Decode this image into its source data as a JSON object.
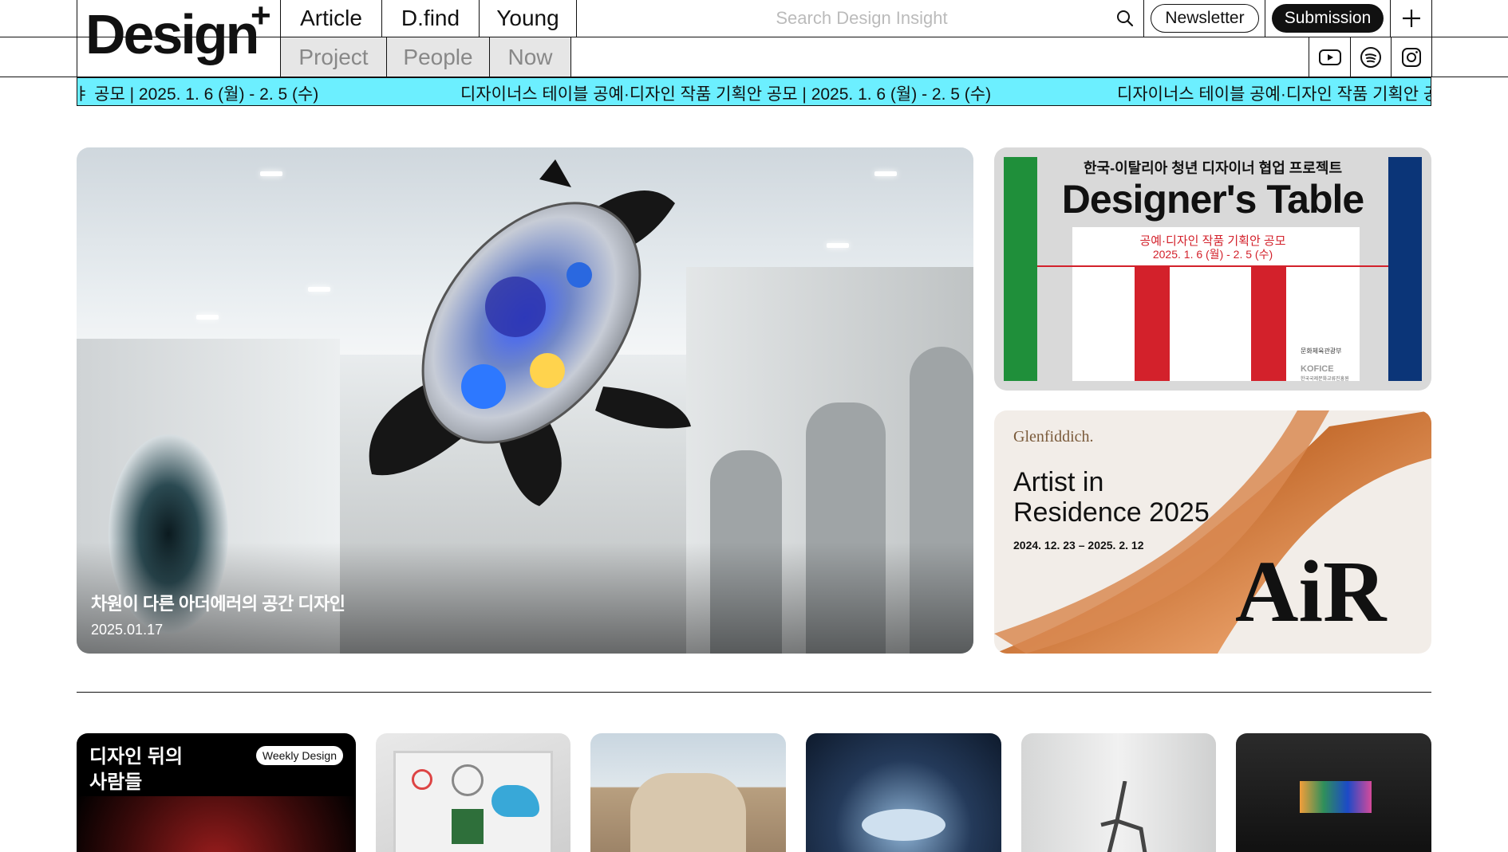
{
  "brand": {
    "logo_text": "Design",
    "logo_plus": "+"
  },
  "nav_top": [
    "Article",
    "D.find",
    "Young"
  ],
  "nav_bottom": [
    "Project",
    "People",
    "Now"
  ],
  "search": {
    "placeholder": "Search Design Insight",
    "icon": "search-icon"
  },
  "buttons": {
    "newsletter": "Newsletter",
    "submission": "Submission",
    "plus": "+"
  },
  "social": [
    "youtube-icon",
    "spotify-icon",
    "instagram-icon"
  ],
  "ticker": {
    "segment_a": "ㅑ 공모 | 2025. 1. 6 (월) - 2. 5 (수)",
    "segment_b": "디자이너스 테이블 공예·디자인 작품 기획안 공모 | 2025. 1. 6 (월) - 2. 5 (수)",
    "segment_c": "디자이너스 테이블 공예·디자인 작품 기획안 공모",
    "background": "#6cefff"
  },
  "hero": {
    "title": "차원이 다른 아더에러의 공간 디자인",
    "date": "2025.01.17"
  },
  "banner_designers_table": {
    "kicker": "한국-이탈리아 청년 디자이너 협업 프로젝트",
    "title": "Designer's Table",
    "subtitle": "공예·디자인 작품 기획안 공모",
    "dates": "2025. 1. 6 (월) - 2. 5 (수)",
    "org_right": "문화체육관광부",
    "org_right_2": "KOFICE",
    "org_right_3": "한국국제문화교류진흥원"
  },
  "banner_glenfiddich": {
    "brand": "Glenfiddich.",
    "title_line1": "Artist in",
    "title_line2": "Residence 2025",
    "dates": "2024. 12. 23 – 2025. 2. 12",
    "logo": "AiR"
  },
  "cards": {
    "first_title_line1": "디자인 뒤의",
    "first_title_line2": "사람들",
    "first_badge": "Weekly Design"
  },
  "colors": {
    "accent": "#6cefff",
    "dark": "#111111",
    "italy_green": "#1f8f3a",
    "italy_red": "#d3212b",
    "france_blue": "#0b3578"
  }
}
